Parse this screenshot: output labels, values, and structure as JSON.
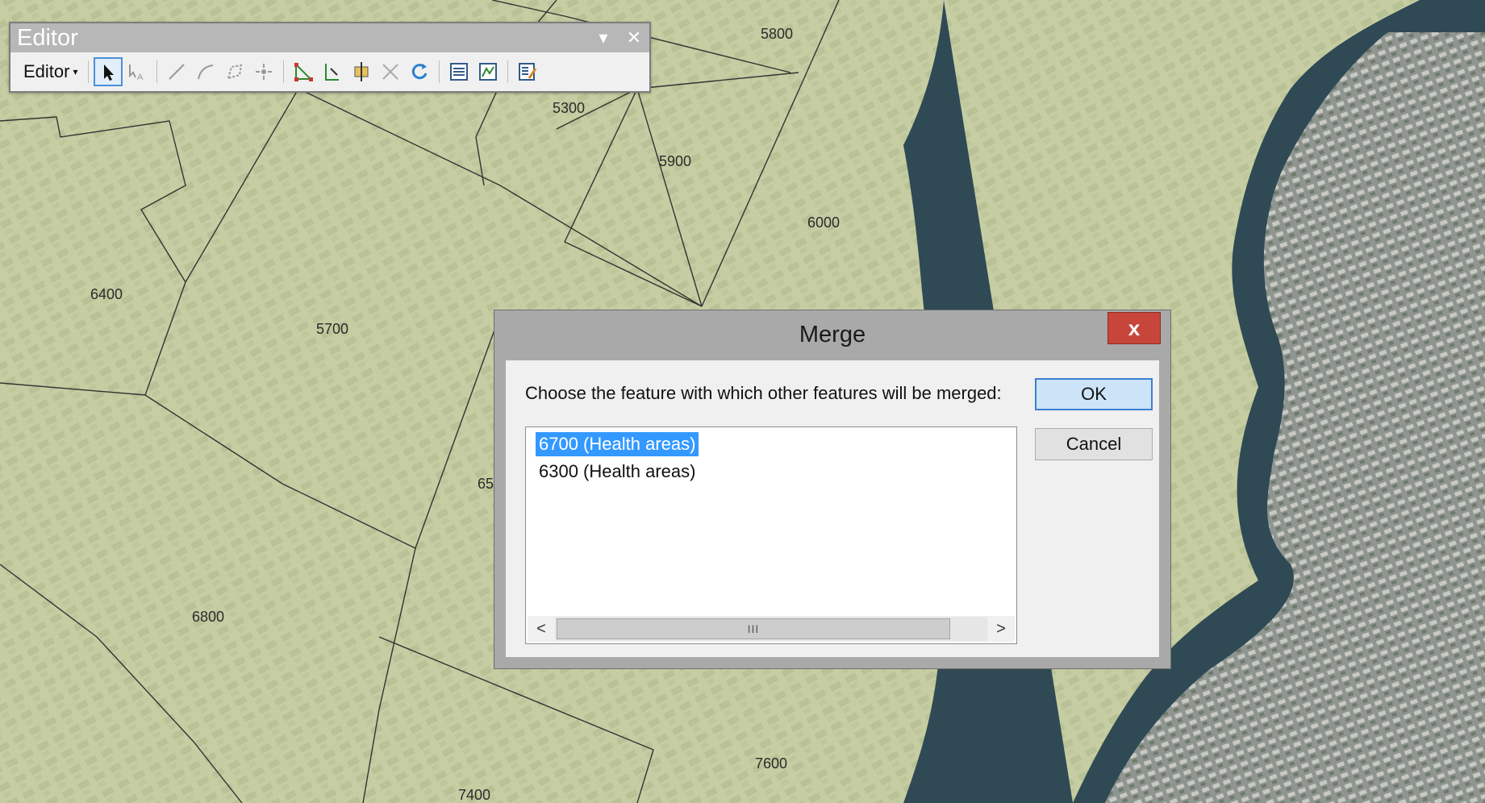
{
  "map": {
    "area_labels": [
      "5800",
      "5300",
      "5900",
      "6000",
      "6400",
      "5700",
      "6800",
      "7600",
      "7400",
      "65"
    ]
  },
  "editor": {
    "title": "Editor",
    "menu_label": "Editor",
    "dropdown_glyph": "▾",
    "close_glyph": "✕",
    "tools": [
      "edit-tool-icon",
      "edit-annotation-icon",
      "straight-segment-icon",
      "end-point-arc-icon",
      "trace-icon",
      "point-icon",
      "edit-vertices-icon",
      "reshape-feature-icon",
      "cut-polygons-icon",
      "split-icon",
      "rotate-icon",
      "attributes-icon",
      "sketch-properties-icon",
      "create-features-icon"
    ]
  },
  "merge": {
    "title": "Merge",
    "close_glyph": "x",
    "prompt": "Choose the feature with which other features will be merged:",
    "items": [
      {
        "label": "6700 (Health areas)",
        "selected": true
      },
      {
        "label": "6300 (Health areas)",
        "selected": false
      }
    ],
    "scroll_left": "<",
    "scroll_right": ">",
    "scroll_grip": "III",
    "ok_label": "OK",
    "cancel_label": "Cancel"
  },
  "colors": {
    "map_fill": "#c9d0a6",
    "water": "#2f4a54",
    "selection": "#3399ff",
    "close_red": "#c7453a"
  }
}
